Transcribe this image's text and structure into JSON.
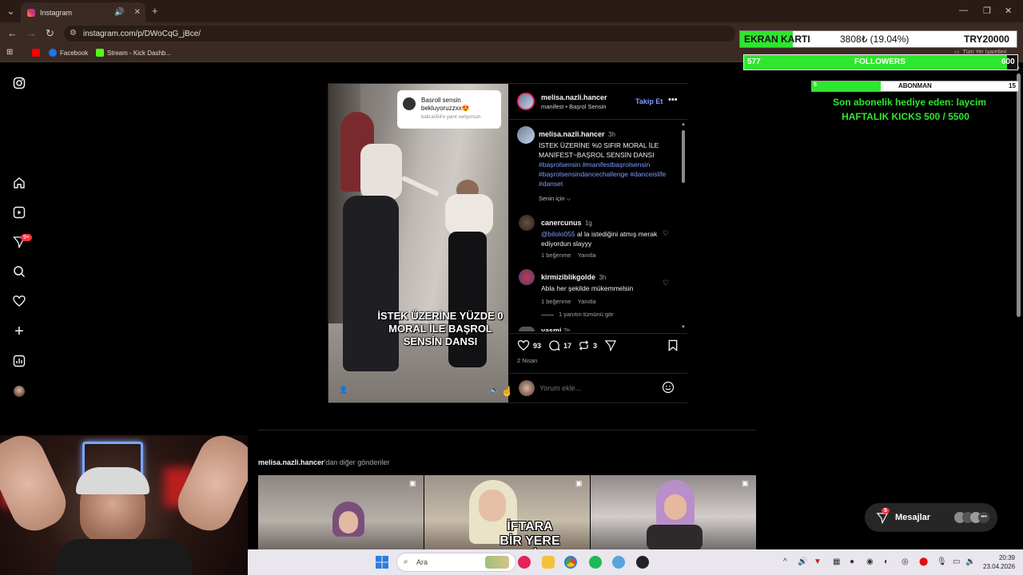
{
  "browser": {
    "tab_title": "Instagram",
    "url": "instagram.com/p/DWoCqG_jBce/",
    "bookmarks": [
      {
        "label": ""
      },
      {
        "label": "Facebook"
      },
      {
        "label": "Stream - Kick Dashb..."
      }
    ],
    "all_bookmarks_label": "Tüm Yer İşaretleri"
  },
  "post": {
    "username": "melisa.nazli.hancer",
    "subtitle": "manifest • Başrol Sensin",
    "follow_label": "Takip Et",
    "story_card": {
      "text": "Basroll sensin bekluyoruzzxx😍",
      "sub": "balican54'e yanıt veriyorsun"
    },
    "video_caption": "İSTEK ÜZERİNE YÜZDE 0 MORAL İLE BAŞROL SENSİN DANSI",
    "caption_user": "melisa.nazli.hancer",
    "caption_time": "3h",
    "caption_text": "İSTEK ÜZERİNE %0 SIFIR MORAL İLE MANİFEST~BAŞROL SENSİN DANSI",
    "hashtags": "#başrolsensin #manifestbaşrolsensin #başrolsensindancechallenge #danceislife #danset",
    "senin_icin": "Senin için",
    "comments": [
      {
        "user": "canercunus",
        "time": "1g",
        "mention": "@bilolo055",
        "text": "al la istediğini atmış merak ediyordun slayyy",
        "likes": "1 beğenme",
        "reply": "Yanıtla"
      },
      {
        "user": "kirmiziblikgolde",
        "time": "3h",
        "mention": "",
        "text": "Abla her şekilde mükemmelsin",
        "likes": "1 beğenme",
        "reply": "Yanıtla"
      }
    ],
    "see_replies": "1 yanıtın tümünü gör",
    "partial_comment": "yasmi",
    "partial_time": "2h",
    "likes_count": "93",
    "comments_count": "17",
    "reposts_count": "3",
    "date": "2 Nisan",
    "comment_placeholder": "Yorum ekle..."
  },
  "more_posts": {
    "user": "melisa.nazli.hancer",
    "suffix": "'dan diğer gönderiler",
    "thumb2_text": "İFTARA BİR YERE Mİ"
  },
  "sidebar": {
    "notification_badge": "9+"
  },
  "messages": {
    "label": "Mesajlar",
    "badge": "5"
  },
  "overlay": {
    "card_label": "EKRAN KARTI",
    "card_value": "3808₺ (19.04%)",
    "card_goal": "TRY20000",
    "card_progress": 0.1904,
    "followers_current": "577",
    "followers_label": "FOLLOWERS",
    "followers_goal": "600",
    "followers_progress": 0.9617,
    "sub_current": "5",
    "sub_label": "ABONMAN",
    "sub_goal": "15",
    "sub_progress": 0.3333,
    "gift_text": "Son abonelik hediye eden: laycim",
    "kicks_text": "HAFTALIK KICKS 500 / 5500"
  },
  "taskbar": {
    "search_placeholder": "Ara",
    "time": "20:39",
    "date": "23.04.2026"
  },
  "colors": {
    "accent_green": "#2ee62e",
    "link_blue": "#7f9bff",
    "instagram_blue": "#0095f6"
  }
}
